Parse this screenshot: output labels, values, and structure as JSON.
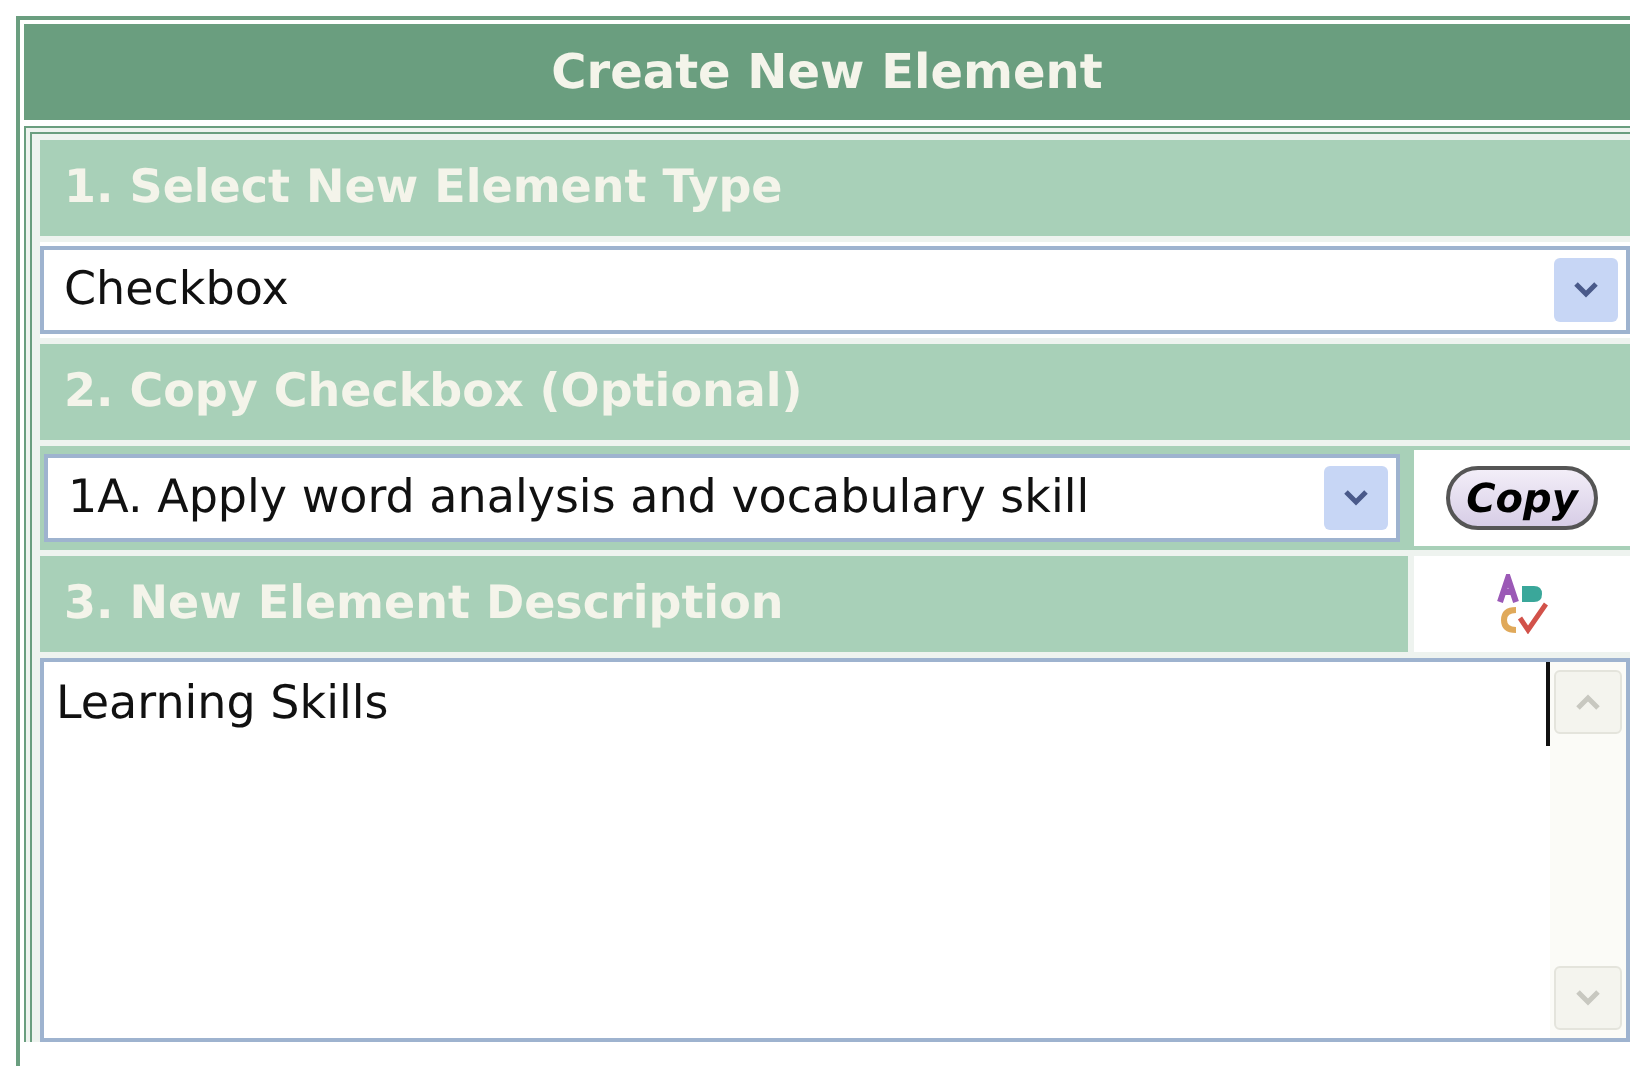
{
  "panel": {
    "title": "Create New Element"
  },
  "sections": [
    {
      "kind": "select",
      "heading": "1. Select New Element Type",
      "value": "Checkbox"
    },
    {
      "kind": "copy",
      "heading": "2. Copy Checkbox (Optional)",
      "value": "1A. Apply word analysis and vocabulary skill",
      "button": "Copy"
    },
    {
      "kind": "description",
      "heading": "3. New Element Description",
      "value": "Learning Skills"
    }
  ]
}
